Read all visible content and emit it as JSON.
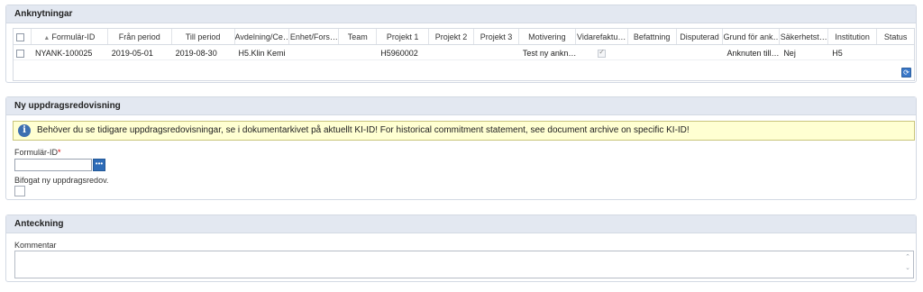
{
  "section1": {
    "title": "Anknytningar",
    "columns": [
      {
        "label": "",
        "w": 20
      },
      {
        "label": "Formulär-ID",
        "w": 85,
        "sort": true
      },
      {
        "label": "Från period",
        "w": 71
      },
      {
        "label": "Till period",
        "w": 70
      },
      {
        "label": "Avdelning/Ce…",
        "w": 61
      },
      {
        "label": "Enhet/Fors…",
        "w": 55
      },
      {
        "label": "Team",
        "w": 42
      },
      {
        "label": "Projekt 1",
        "w": 58
      },
      {
        "label": "Projekt 2",
        "w": 50
      },
      {
        "label": "Projekt 3",
        "w": 50
      },
      {
        "label": "Motivering",
        "w": 63
      },
      {
        "label": "Vidarefaktu…",
        "w": 58
      },
      {
        "label": "Befattning",
        "w": 54
      },
      {
        "label": "Disputerad",
        "w": 52
      },
      {
        "label": "Grund för ank…",
        "w": 63
      },
      {
        "label": "Säkerhetst…",
        "w": 54
      },
      {
        "label": "Institution",
        "w": 54
      },
      {
        "label": "Status",
        "w": 41
      }
    ],
    "rows": [
      [
        "",
        "NYANK-100025",
        "2019-05-01",
        "2019-08-30",
        "H5.Klin Kemi",
        "",
        "",
        "H5960002",
        "",
        "",
        "Test ny ankn…",
        "checked",
        "",
        "",
        "Anknuten till…",
        "Nej",
        "H5",
        ""
      ]
    ]
  },
  "section2": {
    "title": "Ny uppdragsredovisning",
    "info_text": "Behöver du se tidigare uppdragsredovisningar, se i dokumentarkivet på aktuellt KI-ID! For historical commitment statement, see document archive on specific KI-ID!",
    "form_id_label": "Formulär-ID",
    "form_id_required": "*",
    "form_id_value": "",
    "attach_label": "Bifogat ny uppdragsredov."
  },
  "section3": {
    "title": "Anteckning",
    "comment_label": "Kommentar",
    "comment_value": ""
  }
}
